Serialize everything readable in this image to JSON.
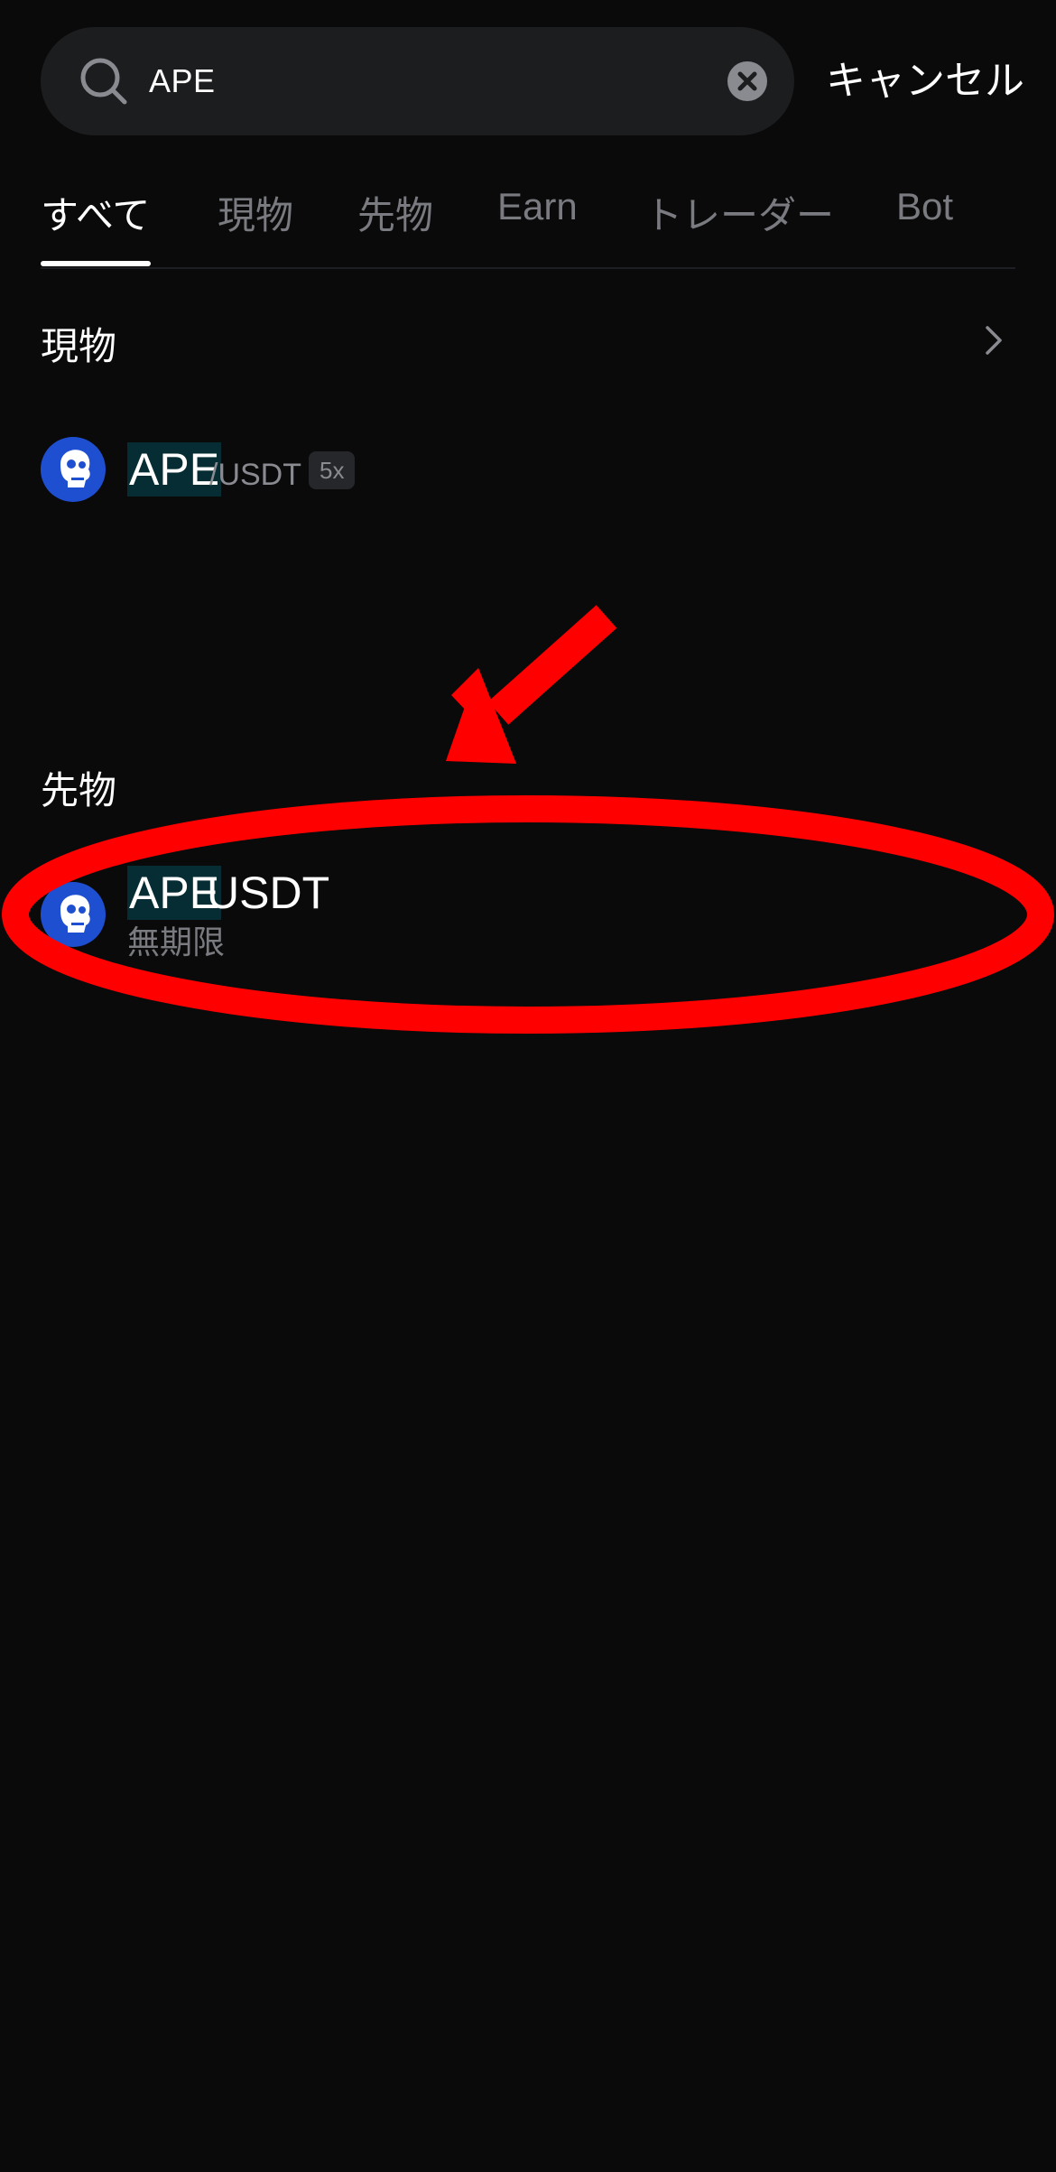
{
  "search": {
    "value": "APE",
    "cancel_label": "キャンセル"
  },
  "tabs": [
    {
      "label": "すべて",
      "active": true
    },
    {
      "label": "現物",
      "active": false
    },
    {
      "label": "先物",
      "active": false
    },
    {
      "label": "Earn",
      "active": false
    },
    {
      "label": "トレーダー",
      "active": false
    },
    {
      "label": "Bot",
      "active": false
    }
  ],
  "spot": {
    "title": "現物",
    "items": [
      {
        "base": "APE",
        "quote": "/USDT",
        "leverage": "5x",
        "icon": "ape-coin-icon"
      }
    ]
  },
  "futures": {
    "title": "先物",
    "items": [
      {
        "base": "APE",
        "quote": "USDT",
        "subtitle": "無期限",
        "icon": "ape-coin-icon"
      }
    ]
  },
  "colors": {
    "background": "#0a0a0a",
    "search_bg": "#1c1d1f",
    "highlight_bg": "#062d33",
    "muted_text": "#7a7b80",
    "annotation_red": "#ff0000",
    "coin_blue": "#1f4fd1"
  }
}
